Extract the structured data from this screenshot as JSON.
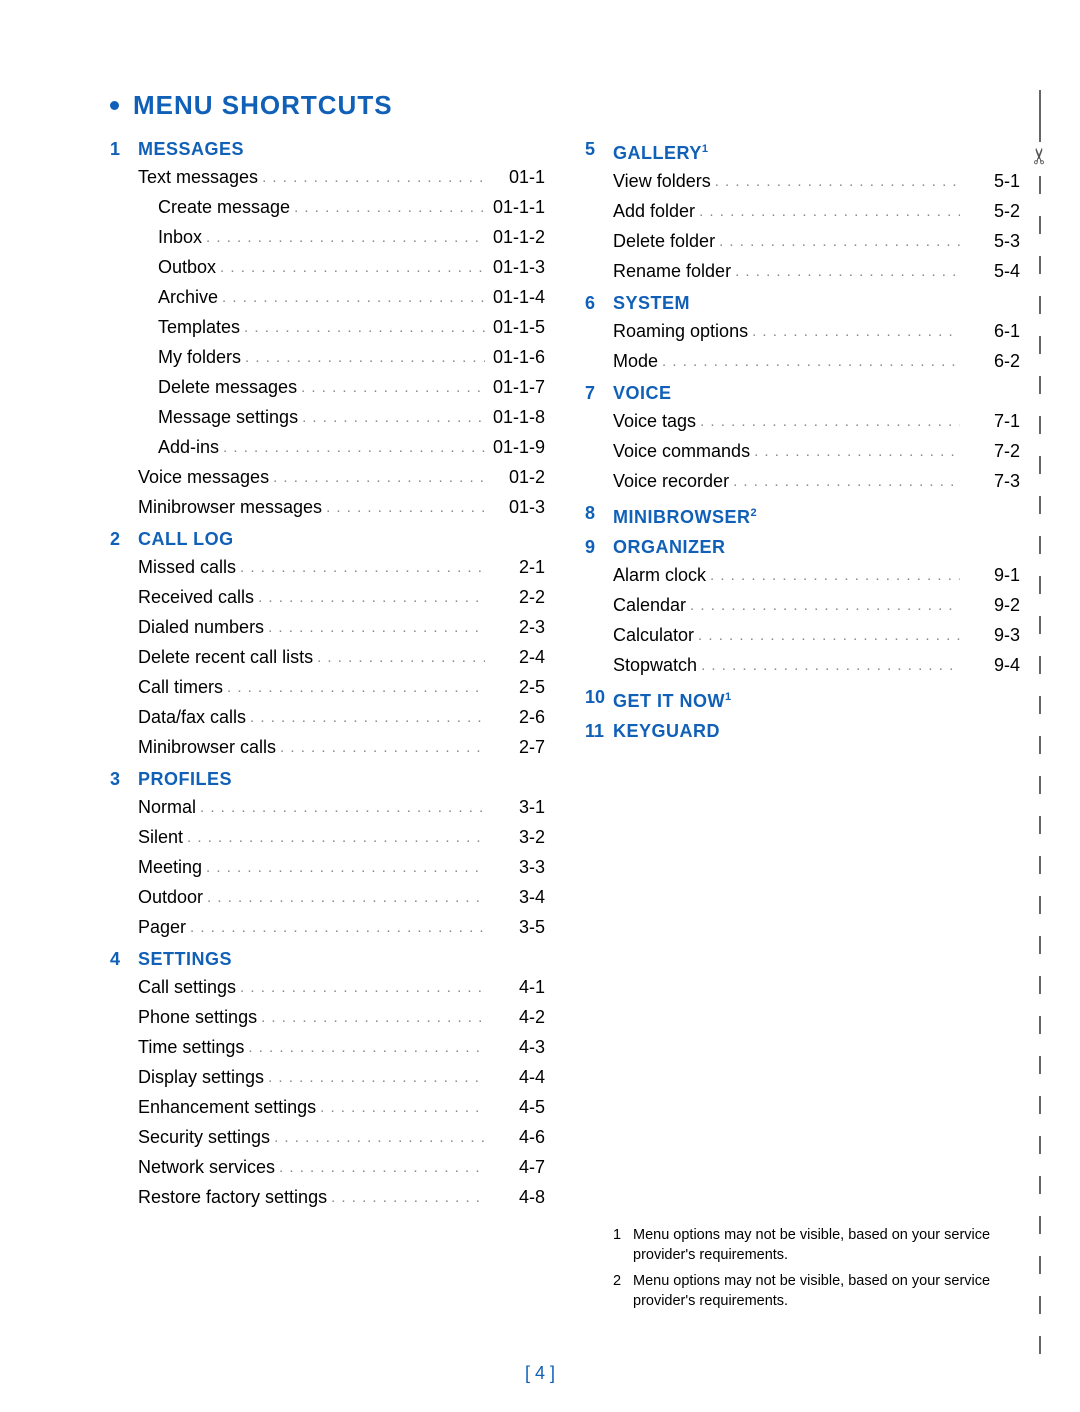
{
  "title": "MENU SHORTCUTS",
  "pageNumber": "[ 4 ]",
  "footnotes": [
    {
      "n": "1",
      "text": "Menu options may not be visible, based on your service provider's requirements."
    },
    {
      "n": "2",
      "text": "Menu options may not be visible, based on your service provider's requirements."
    }
  ],
  "left": [
    {
      "n": "1",
      "title": "MESSAGES",
      "sup": "",
      "items": [
        {
          "label": "Text messages",
          "code": "01-1",
          "indent": 0
        },
        {
          "label": "Create message",
          "code": "01-1-1",
          "indent": 1
        },
        {
          "label": "Inbox",
          "code": "01-1-2",
          "indent": 1
        },
        {
          "label": "Outbox",
          "code": "01-1-3",
          "indent": 1
        },
        {
          "label": "Archive",
          "code": "01-1-4",
          "indent": 1
        },
        {
          "label": "Templates",
          "code": "01-1-5",
          "indent": 1
        },
        {
          "label": "My folders",
          "code": "01-1-6",
          "indent": 1
        },
        {
          "label": "Delete messages",
          "code": "01-1-7",
          "indent": 1
        },
        {
          "label": "Message settings",
          "code": "01-1-8",
          "indent": 1
        },
        {
          "label": "Add-ins",
          "code": "01-1-9",
          "indent": 1
        },
        {
          "label": "Voice messages",
          "code": "01-2",
          "indent": 0
        },
        {
          "label": "Minibrowser messages",
          "code": "01-3",
          "indent": 0
        }
      ]
    },
    {
      "n": "2",
      "title": "CALL LOG",
      "sup": "",
      "items": [
        {
          "label": "Missed calls",
          "code": "2-1",
          "indent": 0
        },
        {
          "label": "Received calls",
          "code": "2-2",
          "indent": 0
        },
        {
          "label": "Dialed numbers",
          "code": "2-3",
          "indent": 0
        },
        {
          "label": "Delete recent call lists",
          "code": "2-4",
          "indent": 0
        },
        {
          "label": "Call timers",
          "code": "2-5",
          "indent": 0
        },
        {
          "label": "Data/fax calls",
          "code": "2-6",
          "indent": 0
        },
        {
          "label": "Minibrowser calls",
          "code": "2-7",
          "indent": 0
        }
      ]
    },
    {
      "n": "3",
      "title": "PROFILES",
      "sup": "",
      "items": [
        {
          "label": "Normal",
          "code": "3-1",
          "indent": 0
        },
        {
          "label": "Silent",
          "code": "3-2",
          "indent": 0
        },
        {
          "label": "Meeting",
          "code": "3-3",
          "indent": 0
        },
        {
          "label": "Outdoor",
          "code": "3-4",
          "indent": 0
        },
        {
          "label": "Pager",
          "code": "3-5",
          "indent": 0
        }
      ]
    },
    {
      "n": "4",
      "title": "SETTINGS",
      "sup": "",
      "items": [
        {
          "label": "Call settings",
          "code": "4-1",
          "indent": 0
        },
        {
          "label": "Phone settings",
          "code": "4-2",
          "indent": 0
        },
        {
          "label": "Time settings",
          "code": "4-3",
          "indent": 0
        },
        {
          "label": "Display settings",
          "code": "4-4",
          "indent": 0
        },
        {
          "label": "Enhancement settings",
          "code": "4-5",
          "indent": 0
        },
        {
          "label": "Security settings",
          "code": "4-6",
          "indent": 0
        },
        {
          "label": "Network services",
          "code": "4-7",
          "indent": 0
        },
        {
          "label": "Restore factory settings",
          "code": "4-8",
          "indent": 0
        }
      ]
    }
  ],
  "right": [
    {
      "n": "5",
      "title": "GALLERY",
      "sup": "1",
      "items": [
        {
          "label": "View folders",
          "code": "5-1",
          "indent": 0
        },
        {
          "label": "Add folder",
          "code": "5-2",
          "indent": 0
        },
        {
          "label": "Delete folder",
          "code": "5-3",
          "indent": 0
        },
        {
          "label": "Rename folder",
          "code": "5-4",
          "indent": 0
        }
      ]
    },
    {
      "n": "6",
      "title": "SYSTEM",
      "sup": "",
      "items": [
        {
          "label": "Roaming options",
          "code": "6-1",
          "indent": 0
        },
        {
          "label": "Mode",
          "code": "6-2",
          "indent": 0
        }
      ]
    },
    {
      "n": "7",
      "title": "VOICE",
      "sup": "",
      "items": [
        {
          "label": "Voice tags",
          "code": "7-1",
          "indent": 0
        },
        {
          "label": "Voice commands",
          "code": "7-2",
          "indent": 0
        },
        {
          "label": "Voice recorder",
          "code": "7-3",
          "indent": 0
        }
      ]
    },
    {
      "n": "8",
      "title": "MINIBROWSER",
      "sup": "2",
      "items": []
    },
    {
      "n": "9",
      "title": "ORGANIZER",
      "sup": "",
      "items": [
        {
          "label": "Alarm clock",
          "code": "9-1",
          "indent": 0
        },
        {
          "label": "Calendar",
          "code": "9-2",
          "indent": 0
        },
        {
          "label": "Calculator",
          "code": "9-3",
          "indent": 0
        },
        {
          "label": "Stopwatch",
          "code": "9-4",
          "indent": 0
        }
      ]
    },
    {
      "n": "10",
      "title": "GET IT NOW",
      "sup": "1",
      "items": []
    },
    {
      "n": "11",
      "title": "KEYGUARD",
      "sup": "",
      "items": []
    }
  ]
}
